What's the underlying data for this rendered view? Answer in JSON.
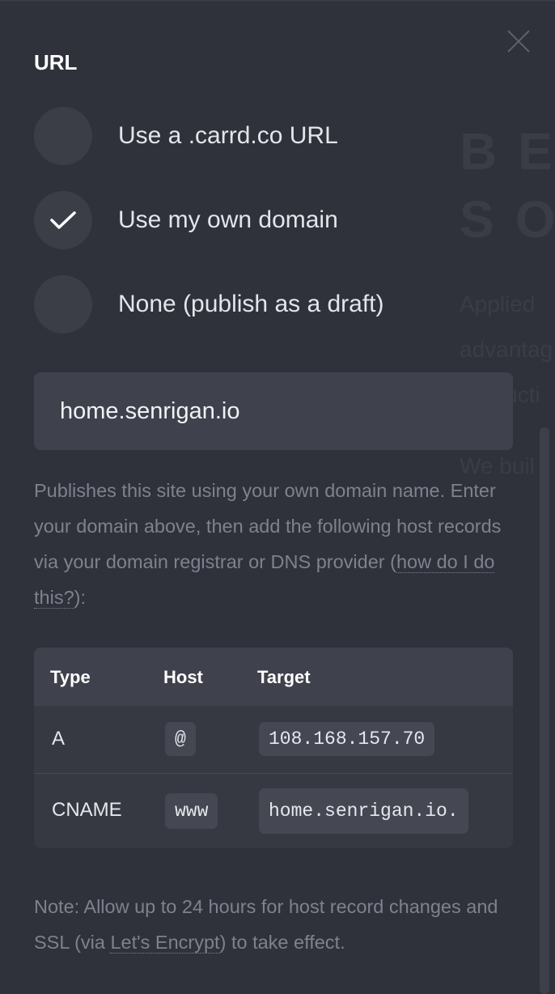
{
  "title": "URL",
  "close_icon": "close-icon",
  "options": [
    {
      "label": "Use a .carrd.co URL",
      "checked": false
    },
    {
      "label": "Use my own domain",
      "checked": true
    },
    {
      "label": "None (publish as a draft)",
      "checked": false
    }
  ],
  "domain_input": {
    "value": "home.senrigan.io"
  },
  "description": {
    "text": "Publishes this site using your own domain name. Enter your domain above, then add the following host records via your domain registrar or DNS provider (",
    "link": "how do I do this?",
    "suffix": "):"
  },
  "records": {
    "headers": [
      "Type",
      "Host",
      "Target"
    ],
    "rows": [
      {
        "type": "A",
        "host": "@",
        "target": "108.168.157.70"
      },
      {
        "type": "CNAME",
        "host": "www",
        "target": "home.senrigan.io."
      }
    ]
  },
  "note": {
    "text": "Note: Allow up to 24 hours for host record changes and SSL (via ",
    "link": "Let's Encrypt",
    "suffix": ") to take effect."
  },
  "background": {
    "heading_1": "BE",
    "heading_2": "SO",
    "lines": [
      "Applied",
      "advantag",
      "producti",
      "We buil"
    ]
  },
  "colors": {
    "background": "#2f313b",
    "surface": "#3f414c",
    "muted_text": "#7f828e"
  }
}
